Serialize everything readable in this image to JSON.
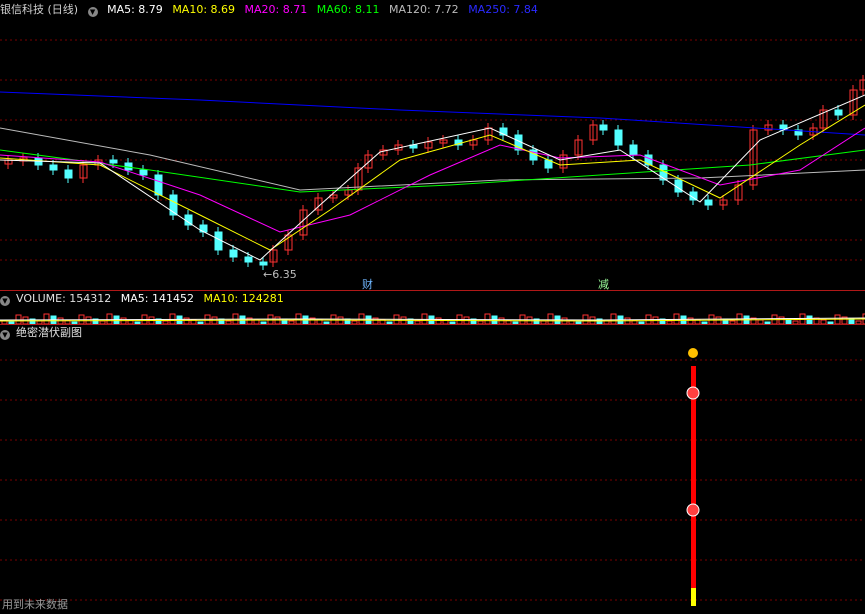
{
  "main_header": {
    "title": "银信科技 (日线)",
    "ma5": "MA5: 8.79",
    "ma10": "MA10: 8.69",
    "ma20": "MA20: 8.71",
    "ma60": "MA60: 8.11",
    "ma120": "MA120: 7.72",
    "ma250": "MA250: 7.84"
  },
  "colors": {
    "ma5": "#ffffff",
    "ma10": "#ffff00",
    "ma20": "#ff00ff",
    "ma60": "#00ff00",
    "ma120": "#bbbbbb",
    "ma250": "#0000ff",
    "up": "#ff3232",
    "down": "#54ffff",
    "grid": "#7a0000",
    "separator": "#b01818"
  },
  "price_chart": {
    "low_label": "6.35",
    "markers": [
      {
        "text": "财",
        "color": "#6fb6ff"
      },
      {
        "text": "减",
        "color": "#9cff9c"
      }
    ]
  },
  "volume_header": {
    "title": "VOLUME: 154312",
    "ma5": "MA5: 141452",
    "ma10": "MA10: 124281"
  },
  "indicator_header": {
    "title": "绝密潜伏副图"
  },
  "footer": {
    "text": "用到未来数据"
  },
  "icons": {
    "panel_menu": "chevron-down-icon"
  }
}
